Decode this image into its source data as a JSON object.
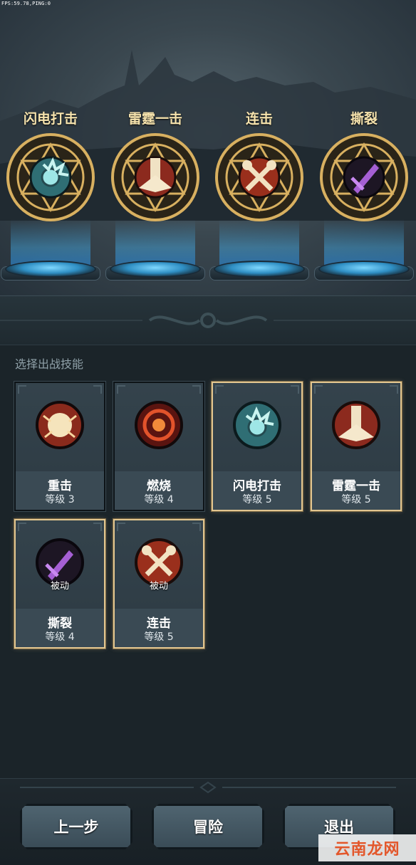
{
  "hud": {
    "fps_text": "FPS:59.78,PING:0"
  },
  "equipped_slots": [
    {
      "name": "闪电打击",
      "icon": "lightning-strike-icon"
    },
    {
      "name": "雷霆一击",
      "icon": "thunder-strike-icon"
    },
    {
      "name": "连击",
      "icon": "combo-axes-icon"
    },
    {
      "name": "撕裂",
      "icon": "rend-sword-icon"
    }
  ],
  "section": {
    "title": "选择出战技能"
  },
  "skills": [
    {
      "name": "重击",
      "level": "等级 3",
      "tag": "",
      "selected": false,
      "icon": "heavy-strike-icon"
    },
    {
      "name": "燃烧",
      "level": "等级 4",
      "tag": "",
      "selected": false,
      "icon": "burn-icon"
    },
    {
      "name": "闪电打击",
      "level": "等级 5",
      "tag": "",
      "selected": true,
      "icon": "lightning-strike-icon"
    },
    {
      "name": "雷霆一击",
      "level": "等级 5",
      "tag": "",
      "selected": true,
      "icon": "thunder-strike-icon"
    },
    {
      "name": "撕裂",
      "level": "等级 4",
      "tag": "被动",
      "selected": true,
      "icon": "rend-sword-icon"
    },
    {
      "name": "连击",
      "level": "等级 5",
      "tag": "被动",
      "selected": true,
      "icon": "combo-axes-icon"
    }
  ],
  "buttons": {
    "back": "上一步",
    "adventure": "冒险",
    "exit": "退出"
  },
  "watermark": {
    "text": "云南龙网"
  },
  "colors": {
    "selected_border": "#e2c690",
    "slot_title": "#f6e3ad",
    "watermark": "#e3572b"
  }
}
